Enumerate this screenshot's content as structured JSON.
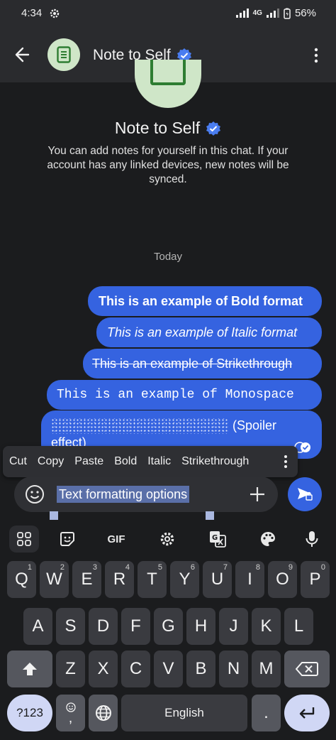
{
  "status_bar": {
    "time": "4:34",
    "network": "4G",
    "battery": "56%"
  },
  "app_bar": {
    "title": "Note to Self"
  },
  "profile": {
    "title": "Note to Self",
    "description": "You can add notes for yourself in this chat. If your account has any linked devices, new notes will be synced."
  },
  "chat": {
    "date_divider": "Today",
    "messages": [
      {
        "text": "This is an example of Bold format",
        "format": "bold"
      },
      {
        "text": "This is an example of Italic format",
        "format": "italic"
      },
      {
        "text": "This is an example of Strikethrough",
        "format": "strikethrough"
      },
      {
        "text": "This is an example of Monospace",
        "format": "monospace"
      },
      {
        "text": "(Spoiler effect)",
        "format": "spoiler",
        "time_partial": "N"
      }
    ]
  },
  "text_toolbar": {
    "items": [
      "Cut",
      "Copy",
      "Paste",
      "Bold",
      "Italic",
      "Strikethrough"
    ]
  },
  "composer": {
    "text": "Text formatting options"
  },
  "keyboard": {
    "toolbar": [
      "grid",
      "sticker",
      "GIF",
      "settings",
      "translate",
      "palette",
      "mic"
    ],
    "gif_label": "GIF",
    "row1": [
      {
        "k": "Q",
        "n": "1"
      },
      {
        "k": "W",
        "n": "2"
      },
      {
        "k": "E",
        "n": "3"
      },
      {
        "k": "R",
        "n": "4"
      },
      {
        "k": "T",
        "n": "5"
      },
      {
        "k": "Y",
        "n": "6"
      },
      {
        "k": "U",
        "n": "7"
      },
      {
        "k": "I",
        "n": "8"
      },
      {
        "k": "O",
        "n": "9"
      },
      {
        "k": "P",
        "n": "0"
      }
    ],
    "row2": [
      "A",
      "S",
      "D",
      "F",
      "G",
      "H",
      "J",
      "K",
      "L"
    ],
    "row3": [
      "Z",
      "X",
      "C",
      "V",
      "B",
      "N",
      "M"
    ],
    "symbols_key": "?123",
    "comma": ",",
    "period": ".",
    "space_label": "English"
  },
  "colors": {
    "accent": "#3563e0",
    "background": "#1b1c1e",
    "bar": "#2a2b2e"
  }
}
